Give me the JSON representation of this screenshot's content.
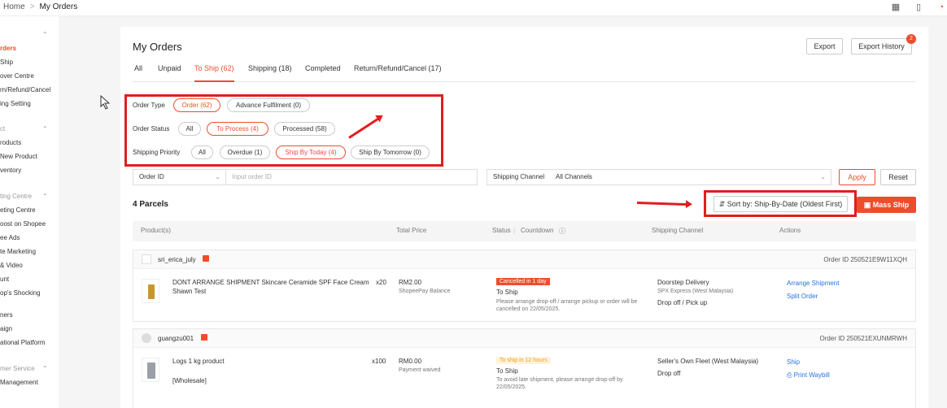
{
  "breadcrumb": {
    "home": "Home",
    "separator": ">",
    "current": "My Orders"
  },
  "top_icons": [
    "grid-icon",
    "book-icon",
    "bell-icon"
  ],
  "sidebar": {
    "items": [
      {
        "text": "rders",
        "active": true
      },
      {
        "text": "Ship"
      },
      {
        "text": "over Centre"
      },
      {
        "text": "rn/Refund/Cancel"
      },
      {
        "text": "ing Setting"
      },
      {
        "text": "ct",
        "head": true
      },
      {
        "text": "roducts"
      },
      {
        "text": "New Product"
      },
      {
        "text": "ventory"
      },
      {
        "text": "ting Centre",
        "head": true
      },
      {
        "text": "eting Centre"
      },
      {
        "text": "oost on Shopee"
      },
      {
        "text": "ee Ads"
      },
      {
        "text": "te Marketing"
      },
      {
        "text": "& Video"
      },
      {
        "text": "unt"
      },
      {
        "text": "op's Shocking"
      },
      {
        "text": "ners"
      },
      {
        "text": "aign"
      },
      {
        "text": "ational Platform"
      },
      {
        "text": "mer Service",
        "head": true
      },
      {
        "text": "Management"
      }
    ]
  },
  "header": {
    "title": "My Orders",
    "export": "Export",
    "export_history": "Export History",
    "history_badge": "2"
  },
  "tabs": [
    "All",
    "Unpaid",
    "To Ship (62)",
    "Shipping (18)",
    "Completed",
    "Return/Refund/Cancel (17)"
  ],
  "filters": {
    "order_type_label": "Order Type",
    "order_type": [
      "Order (62)",
      "Advance Fulfilment (0)"
    ],
    "order_status_label": "Order Status",
    "order_status": [
      "All",
      "To Process (4)",
      "Processed (58)"
    ],
    "priority_label": "Shipping Priority",
    "priority": [
      "All",
      "Overdue (1)",
      "Ship By Today (4)",
      "Ship By Tomorrow (0)"
    ]
  },
  "search": {
    "field": "Order ID",
    "placeholder": "Input order ID",
    "channel_label": "Shipping Channel",
    "channel_value": "All Channels",
    "apply": "Apply",
    "reset": "Reset"
  },
  "list": {
    "count": "4 Parcels",
    "sort": "Sort by: Ship-By-Date (Oldest First)",
    "mass_ship": "Mass Ship"
  },
  "table_headers": {
    "product": "Product(s)",
    "price": "Total Price",
    "status": "Status",
    "countdown": "Countdown",
    "channel": "Shipping Channel",
    "actions": "Actions"
  },
  "orders": [
    {
      "user": "sri_erica_july",
      "order_id": "Order ID 250521E9W11XQH",
      "product": "DONT ARRANGE SHIPMENT Skincare Ceramide SPF Face Cream Shawn Test",
      "product_line1": "DONT ARRANGE SHIPMENT Skincare Ceramide SPF Face Cream",
      "product_line2": "Shawn Test",
      "qty": "x20",
      "price": "RM2.00",
      "payment": "ShopeePay Balance",
      "tag": "Cancelled in 1 day",
      "status": "To Ship",
      "note1": "Please arrange drop-off / arrange pickup or order will be",
      "note2": "cancelled on 22/05/2025.",
      "channel": "Doorstep Delivery",
      "channel_sub": "SPX Express (West Malaysia)",
      "channel_sub2": "Drop off / Pick up",
      "action1": "Arrange Shipment",
      "action2": "Split Order"
    },
    {
      "user": "guangzu001",
      "order_id": "Order ID 250521EXUNMRWH",
      "product_line1": "Logs 1 kg product",
      "product_line2": "[Wholesale]",
      "qty": "x100",
      "price": "RM0.00",
      "payment": "Payment waived",
      "tag": "To ship in 12 hours",
      "status": "To Ship",
      "note1": "To avoid late shipment, please arrange drop-off by",
      "note2": "22/05/2025.",
      "channel": "Seller's Own Fleet (West Malaysia)",
      "channel_sub2": "Drop off",
      "action1": "Ship",
      "action2": "Print Waybill"
    }
  ],
  "colors": {
    "accent": "#ee4d2d",
    "annotation_red": "#e01e1e",
    "link": "#2673dd"
  }
}
